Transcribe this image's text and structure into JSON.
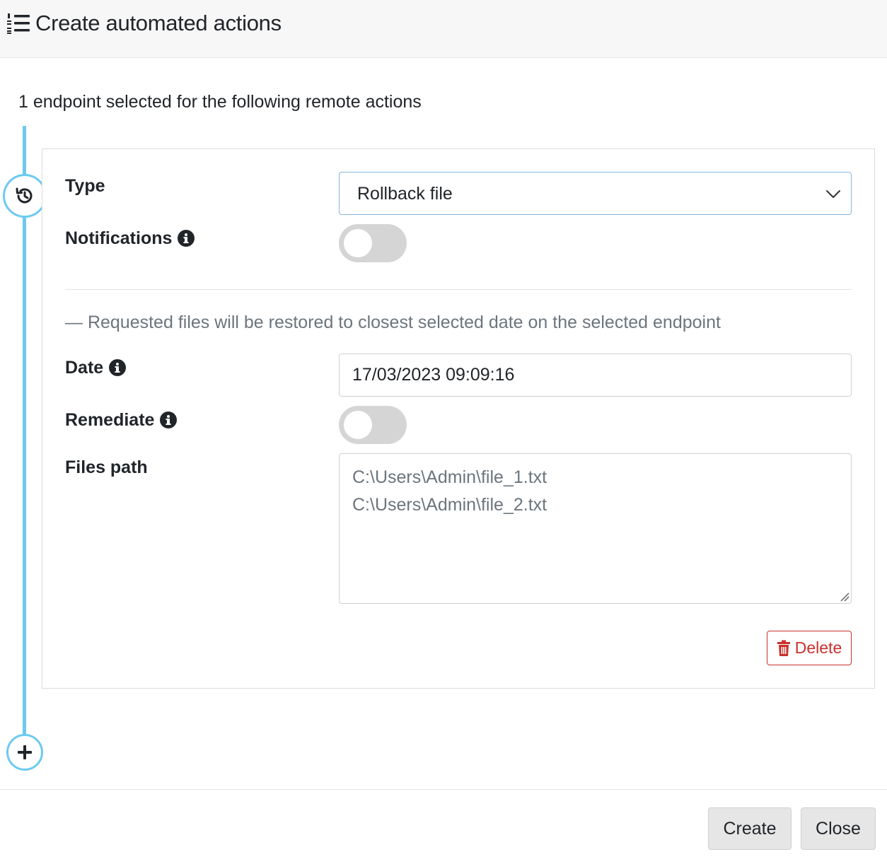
{
  "header": {
    "title": "Create automated actions",
    "icon": "list-ordered-icon"
  },
  "subtitle": "1 endpoint selected for the following remote actions",
  "timeline": {
    "step_icon": "history-icon",
    "add_icon": "plus-icon",
    "accent_color": "#6ccaf0"
  },
  "action": {
    "type": {
      "label": "Type",
      "value": "Rollback file"
    },
    "notifications": {
      "label": "Notifications",
      "enabled": false
    },
    "help_text": "— Requested files will be restored to closest selected date on the selected endpoint",
    "date": {
      "label": "Date",
      "value": "17/03/2023 09:09:16"
    },
    "remediate": {
      "label": "Remediate",
      "enabled": false
    },
    "files_path": {
      "label": "Files path",
      "lines": [
        "C:\\Users\\Admin\\file_1.txt",
        "C:\\Users\\Admin\\file_2.txt"
      ]
    },
    "delete_label": "Delete",
    "delete_color": "#c9302c"
  },
  "footer": {
    "create_label": "Create",
    "close_label": "Close"
  }
}
